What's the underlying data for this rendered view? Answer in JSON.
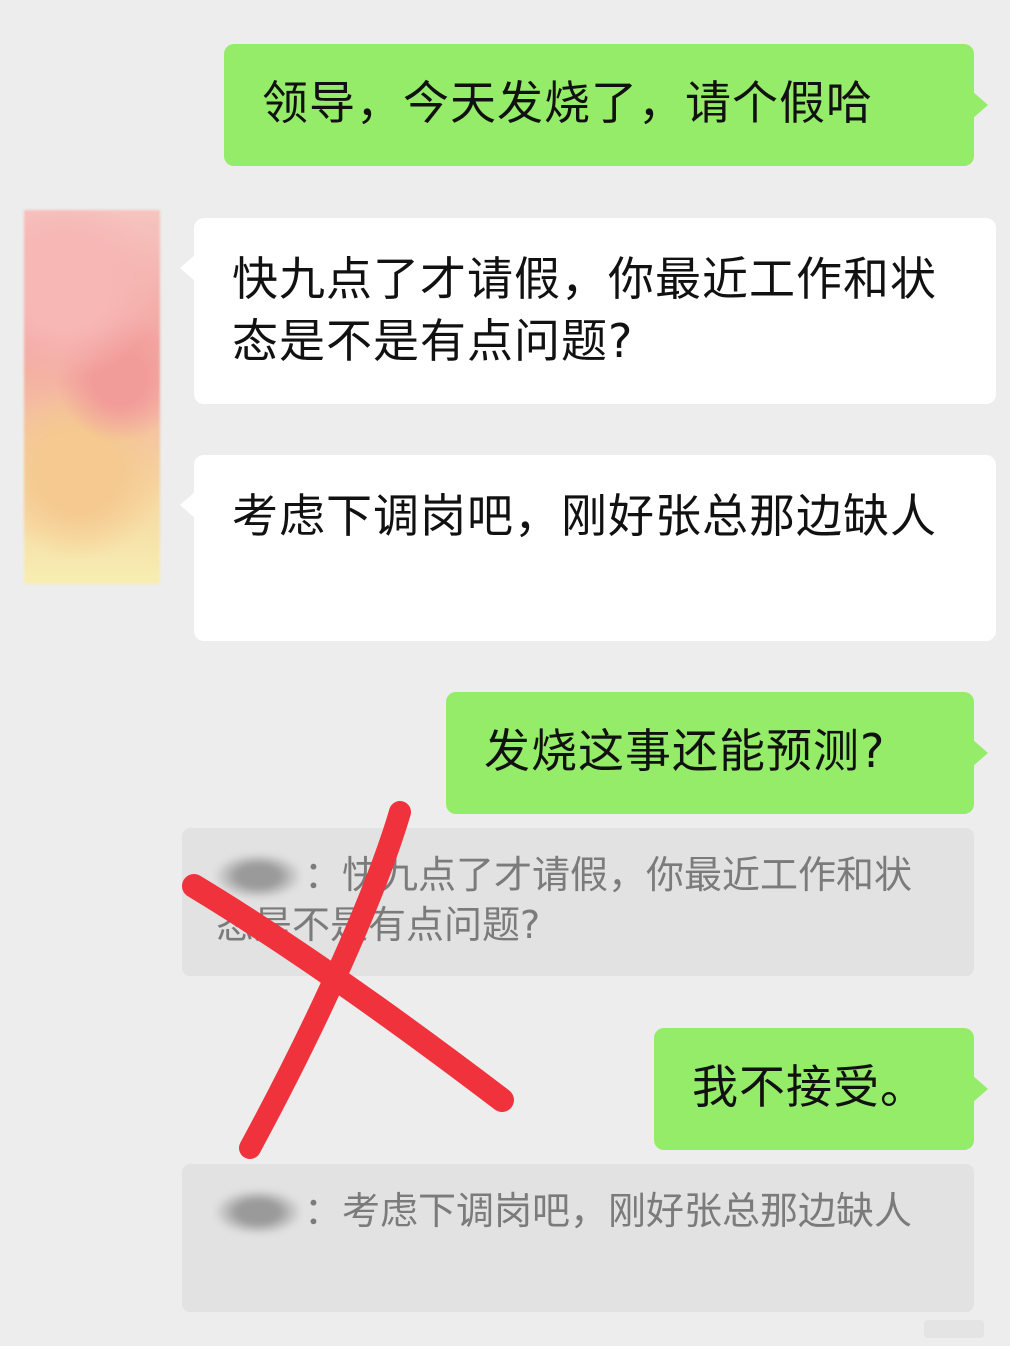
{
  "messages": [
    {
      "side": "me",
      "text": "领导，今天发烧了，请个假哈"
    },
    {
      "side": "them",
      "text": "快九点了才请假，你最近工作和状态是不是有点问题?"
    },
    {
      "side": "them",
      "text": "考虑下调岗吧，刚好张总那边缺人"
    },
    {
      "side": "me",
      "text": "发烧这事还能预测?"
    },
    {
      "side": "quote",
      "text": "：快九点了才请假，你最近工作和状态是不是有点问题?"
    },
    {
      "side": "me",
      "text": "我不接受。"
    },
    {
      "side": "quote",
      "text": "：考虑下调岗吧，刚好张总那边缺人"
    }
  ],
  "colors": {
    "background": "#ededed",
    "my_bubble": "#95ec69",
    "their_bubble": "#ffffff",
    "quote_bubble": "#e2e2e2",
    "cross_mark": "#f0323c"
  },
  "icons": [
    "contact-avatar-blurred",
    "red-cross-mark"
  ]
}
